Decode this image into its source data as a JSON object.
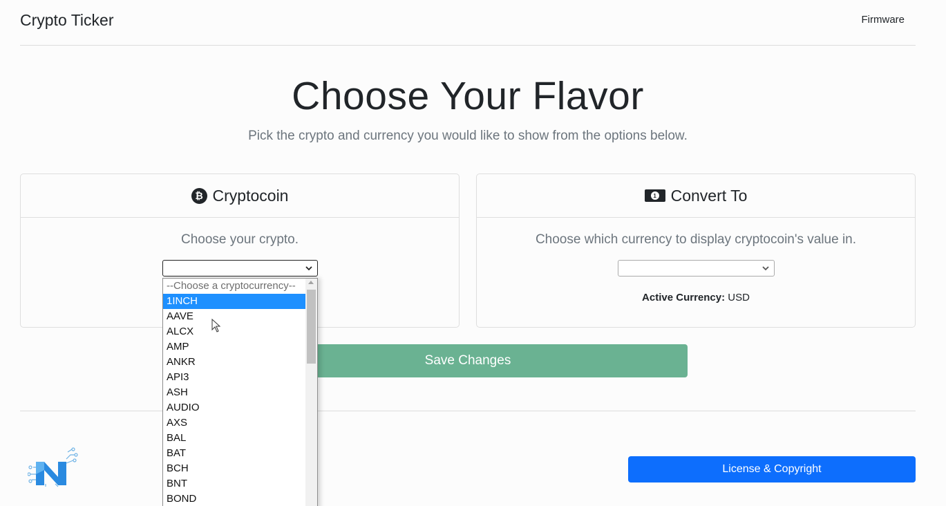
{
  "header": {
    "brand": "Crypto Ticker",
    "nav_firmware": "Firmware"
  },
  "hero": {
    "title": "Choose Your Flavor",
    "subtitle": "Pick the crypto and currency you would like to show from the options below."
  },
  "crypto_card": {
    "icon": "bitcoin-icon",
    "title": "Cryptocoin",
    "text": "Choose your crypto.",
    "select_value": ""
  },
  "currency_card": {
    "icon": "cash-icon",
    "title": "Convert To",
    "text": "Choose which currency to display cryptocoin's value in.",
    "select_value": "",
    "active_label": "Active Currency:",
    "active_value": "USD"
  },
  "save_button": "Save Changes",
  "license_button": "License & Copyright",
  "dropdown": {
    "placeholder": "--Choose a cryptocurrency--",
    "selected_index": 0,
    "options": [
      "1INCH",
      "AAVE",
      "ALCX",
      "AMP",
      "ANKR",
      "API3",
      "ASH",
      "AUDIO",
      "AXS",
      "BAL",
      "BAT",
      "BCH",
      "BNT",
      "BOND"
    ]
  },
  "colors": {
    "save_button": "#6ab292",
    "license_button": "#0d6efd",
    "highlight": "#1e90ff"
  }
}
